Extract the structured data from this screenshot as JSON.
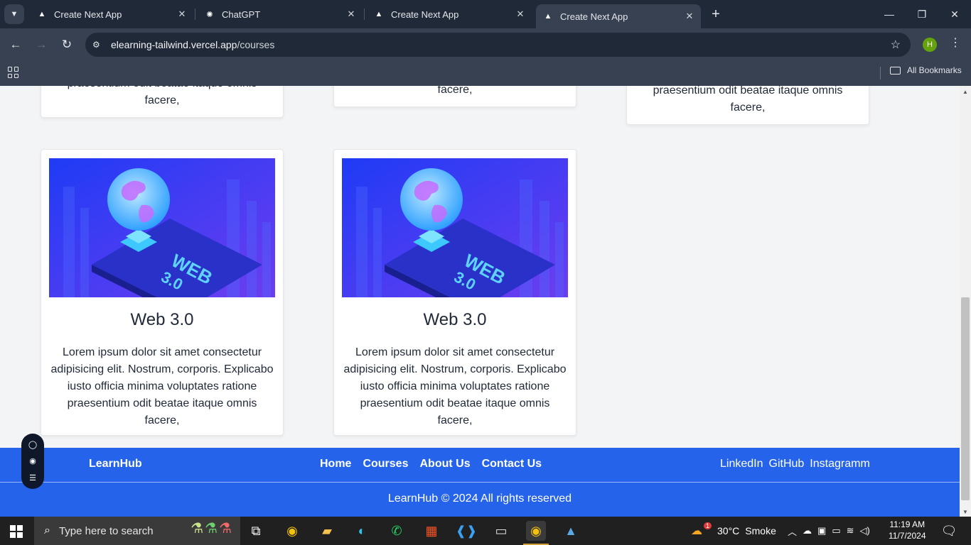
{
  "browser": {
    "tabs": [
      {
        "title": "Create Next App",
        "icon": "nextjs-icon",
        "active": false
      },
      {
        "title": "ChatGPT",
        "icon": "chatgpt-icon",
        "active": false
      },
      {
        "title": "Create Next App",
        "icon": "nextjs-icon",
        "active": false
      },
      {
        "title": "Create Next App",
        "icon": "nextjs-icon",
        "active": true
      }
    ],
    "url_host": "elearning-tailwind.vercel.app",
    "url_path": "/courses",
    "profile_initial": "H",
    "all_bookmarks": "All Bookmarks"
  },
  "courses": {
    "partial_top": [
      {
        "lines": [
          "praesentium odit beatae itaque omnis",
          "facere,"
        ]
      },
      {
        "lines": [
          "facere,"
        ]
      },
      {
        "lines": [
          "praesentium odit beatae itaque omnis",
          "facere,"
        ]
      }
    ],
    "cards": [
      {
        "title": "Web 3.0",
        "image_label": "WEB 3.0",
        "description": "Lorem ipsum dolor sit amet consectetur adipisicing elit. Nostrum, corporis. Explicabo iusto officia minima voluptates ratione praesentium odit beatae itaque omnis facere,"
      },
      {
        "title": "Web 3.0",
        "image_label": "WEB 3.0",
        "description": "Lorem ipsum dolor sit amet consectetur adipisicing elit. Nostrum, corporis. Explicabo iusto officia minima voluptates ratione praesentium odit beatae itaque omnis facere,"
      }
    ]
  },
  "footer": {
    "brand": "LearnHub",
    "nav": [
      "Home",
      "Courses",
      "About Us",
      "Contact Us"
    ],
    "social": [
      "LinkedIn",
      "GitHub",
      "Instagramm"
    ],
    "copyright": "LearnHub © 2024 All rights reserved",
    "color": "#2563eb"
  },
  "taskbar": {
    "search_placeholder": "Type here to search",
    "weather_temp": "30°C",
    "weather_text": "Smoke",
    "weather_badge": "1",
    "time": "11:19 AM",
    "date": "11/7/2024"
  }
}
